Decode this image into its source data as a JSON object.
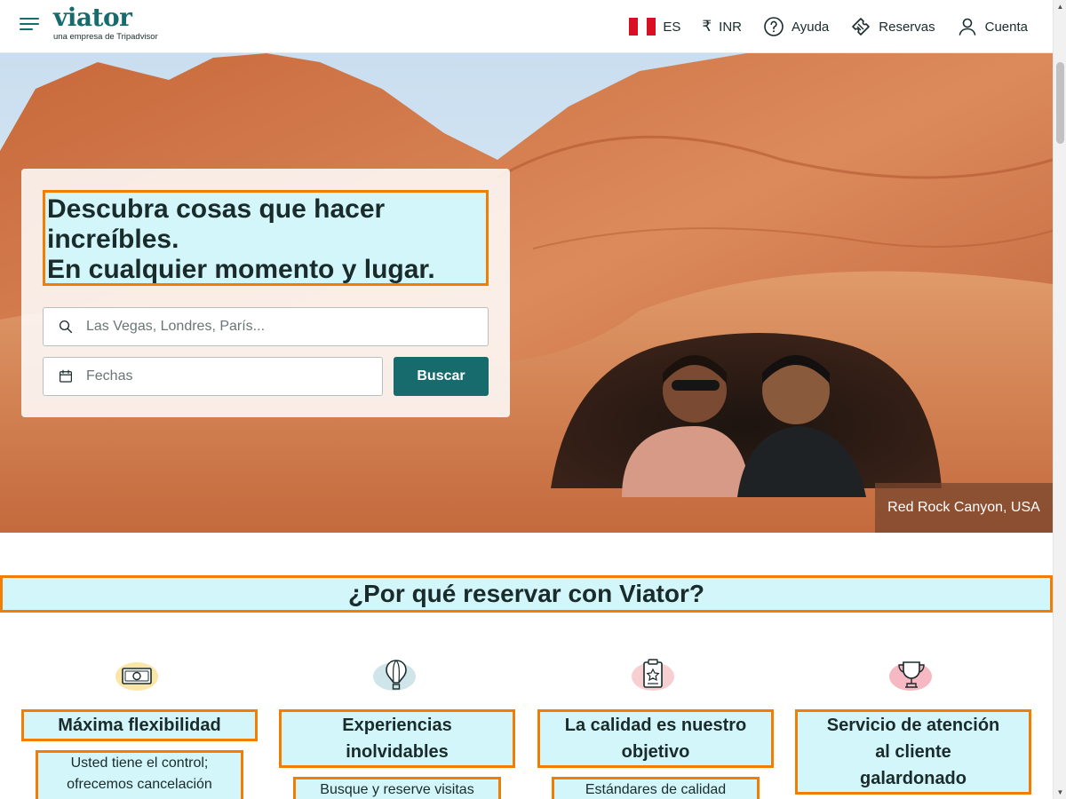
{
  "header": {
    "logo": {
      "name": "viator",
      "tagline": "una empresa de Tripadvisor"
    },
    "nav": {
      "language": "ES",
      "currency_symbol": "₹",
      "currency": "INR",
      "help": "Ayuda",
      "bookings": "Reservas",
      "account": "Cuenta"
    }
  },
  "hero": {
    "headline_lines": [
      "Descubra cosas que hacer",
      "increíbles.",
      "En cualquier momento y lugar."
    ],
    "search": {
      "destination_placeholder": "Las Vegas, Londres, París...",
      "dates_placeholder": "Fechas",
      "submit_label": "Buscar"
    },
    "photo_caption": "Red Rock Canyon, USA"
  },
  "why": {
    "title": "¿Por qué reservar con Viator?",
    "features": [
      {
        "icon": "money-icon",
        "title_lines": [
          "Máxima flexibilidad"
        ],
        "desc_lines": [
          "Usted tiene el control;",
          "ofrecemos cancelación"
        ]
      },
      {
        "icon": "hot-air-balloon-icon",
        "title_lines": [
          "Experiencias",
          "inolvidables"
        ],
        "desc_lines": [
          "Busque y reserve visitas"
        ]
      },
      {
        "icon": "quality-badge-icon",
        "title_lines": [
          "La calidad es nuestro",
          "objetivo"
        ],
        "desc_lines": [
          "Estándares de calidad"
        ]
      },
      {
        "icon": "trophy-icon",
        "title_lines": [
          "Servicio de atención",
          "al cliente",
          "galardonado"
        ],
        "desc_lines": []
      }
    ]
  },
  "colors": {
    "brand": "#186b6d",
    "highlight_fill": "#d2f6fa",
    "highlight_border": "#f27d00"
  }
}
